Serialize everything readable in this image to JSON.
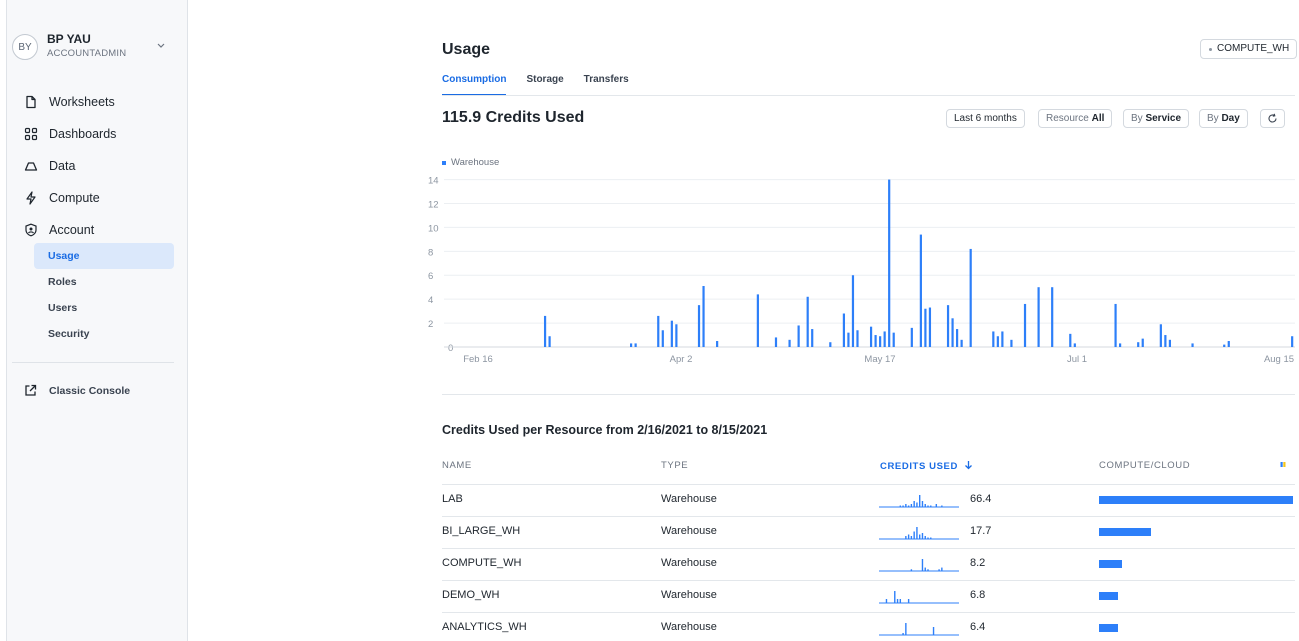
{
  "user": {
    "initials": "BY",
    "name": "BP YAU",
    "role": "ACCOUNTADMIN"
  },
  "nav": {
    "items": [
      {
        "label": "Worksheets",
        "icon": "file-icon"
      },
      {
        "label": "Dashboards",
        "icon": "grid-icon"
      },
      {
        "label": "Data",
        "icon": "cloud-icon"
      },
      {
        "label": "Compute",
        "icon": "bolt-icon"
      },
      {
        "label": "Account",
        "icon": "shield-icon"
      }
    ],
    "subitems": [
      "Usage",
      "Roles",
      "Users",
      "Security"
    ],
    "active_subitem": "Usage",
    "classic": "Classic Console"
  },
  "header": {
    "title": "Usage",
    "warehouse": "COMPUTE_WH",
    "tabs": [
      "Consumption",
      "Storage",
      "Transfers"
    ],
    "active_tab": "Consumption"
  },
  "summary": {
    "credits": "115.9 Credits Used"
  },
  "filters": {
    "range": "Last 6 months",
    "resource_label": "Resource",
    "resource_value": "All",
    "service_label": "By",
    "service_value": "Service",
    "day_label": "By",
    "day_value": "Day"
  },
  "colors": {
    "accent": "#1a6ce4",
    "bar": "#2d7ff9",
    "cloud": "#f5c518"
  },
  "chart_data": {
    "type": "bar",
    "series": [
      {
        "name": "Warehouse"
      }
    ],
    "x_start": "2021-02-16",
    "x_end": "2021-08-15",
    "xticks": [
      "Feb 16",
      "Apr 2",
      "May 17",
      "Jul 1",
      "Aug 15"
    ],
    "yticks": [
      0,
      2,
      4,
      6,
      8,
      10,
      12,
      14
    ],
    "ylim": [
      0,
      14.8
    ],
    "points": [
      [
        "2021-03-05",
        2.6
      ],
      [
        "2021-03-06",
        0.9
      ],
      [
        "2021-03-24",
        0.3
      ],
      [
        "2021-03-25",
        0.3
      ],
      [
        "2021-03-30",
        2.6
      ],
      [
        "2021-03-31",
        1.4
      ],
      [
        "2021-04-02",
        2.2
      ],
      [
        "2021-04-03",
        1.9
      ],
      [
        "2021-04-08",
        3.5
      ],
      [
        "2021-04-09",
        5.1
      ],
      [
        "2021-04-12",
        0.5
      ],
      [
        "2021-04-21",
        4.4
      ],
      [
        "2021-04-25",
        0.8
      ],
      [
        "2021-04-28",
        0.6
      ],
      [
        "2021-04-30",
        1.8
      ],
      [
        "2021-05-02",
        4.2
      ],
      [
        "2021-05-03",
        1.5
      ],
      [
        "2021-05-07",
        0.4
      ],
      [
        "2021-05-10",
        2.8
      ],
      [
        "2021-05-11",
        1.2
      ],
      [
        "2021-05-12",
        6.0
      ],
      [
        "2021-05-13",
        1.4
      ],
      [
        "2021-05-16",
        1.7
      ],
      [
        "2021-05-17",
        1.0
      ],
      [
        "2021-05-18",
        0.9
      ],
      [
        "2021-05-19",
        1.3
      ],
      [
        "2021-05-20",
        14.0
      ],
      [
        "2021-05-21",
        1.2
      ],
      [
        "2021-05-25",
        1.6
      ],
      [
        "2021-05-27",
        9.4
      ],
      [
        "2021-05-28",
        3.2
      ],
      [
        "2021-05-29",
        3.3
      ],
      [
        "2021-06-02",
        3.5
      ],
      [
        "2021-06-03",
        2.4
      ],
      [
        "2021-06-04",
        1.5
      ],
      [
        "2021-06-05",
        0.6
      ],
      [
        "2021-06-07",
        8.2
      ],
      [
        "2021-06-12",
        1.3
      ],
      [
        "2021-06-13",
        0.9
      ],
      [
        "2021-06-14",
        1.3
      ],
      [
        "2021-06-16",
        0.6
      ],
      [
        "2021-06-19",
        3.6
      ],
      [
        "2021-06-22",
        5.0
      ],
      [
        "2021-06-25",
        5.0
      ],
      [
        "2021-06-29",
        1.1
      ],
      [
        "2021-06-30",
        0.3
      ],
      [
        "2021-07-09",
        3.6
      ],
      [
        "2021-07-10",
        0.3
      ],
      [
        "2021-07-14",
        0.4
      ],
      [
        "2021-07-15",
        0.7
      ],
      [
        "2021-07-19",
        1.9
      ],
      [
        "2021-07-20",
        1.0
      ],
      [
        "2021-07-21",
        0.6
      ],
      [
        "2021-07-26",
        0.3
      ],
      [
        "2021-08-02",
        0.2
      ],
      [
        "2021-08-03",
        0.5
      ],
      [
        "2021-08-17",
        0.9
      ]
    ]
  },
  "table": {
    "title": "Credits Used per Resource from 2/16/2021 to 8/15/2021",
    "columns": [
      "NAME",
      "TYPE",
      "CREDITS USED",
      "COMPUTE/CLOUD"
    ],
    "rows": [
      {
        "name": "LAB",
        "type": "Warehouse",
        "credits": "66.4",
        "share": 1.0,
        "spark": [
          0,
          0,
          0,
          0,
          0,
          0,
          1,
          1,
          2,
          1,
          2,
          4,
          3,
          8,
          4,
          2,
          1,
          1,
          0,
          2,
          0,
          1,
          0,
          0,
          0,
          0
        ]
      },
      {
        "name": "BI_LARGE_WH",
        "type": "Warehouse",
        "credits": "17.7",
        "share": 0.27,
        "spark": [
          0,
          0,
          0,
          0,
          0,
          0,
          0,
          0,
          2,
          3,
          2,
          5,
          8,
          3,
          4,
          2,
          1,
          1,
          0,
          0,
          0,
          0,
          0,
          0,
          0,
          0
        ]
      },
      {
        "name": "COMPUTE_WH",
        "type": "Warehouse",
        "credits": "8.2",
        "share": 0.12,
        "spark": [
          0,
          0,
          0,
          0,
          0,
          0,
          0,
          0,
          0,
          0,
          1,
          0,
          0,
          0,
          7,
          2,
          1,
          0,
          0,
          0,
          1,
          2,
          0,
          0,
          0,
          0
        ]
      },
      {
        "name": "DEMO_WH",
        "type": "Warehouse",
        "credits": "6.8",
        "share": 0.1,
        "spark": [
          0,
          1,
          0,
          0,
          3,
          1,
          1,
          0,
          0,
          1,
          0,
          0,
          0,
          0,
          0,
          0,
          0,
          0,
          0,
          0,
          0,
          0,
          0,
          0,
          0,
          0
        ]
      },
      {
        "name": "ANALYTICS_WH",
        "type": "Warehouse",
        "credits": "6.4",
        "share": 0.1,
        "spark": [
          0,
          0,
          0,
          0,
          0,
          0,
          0,
          1,
          6,
          0,
          0,
          0,
          0,
          0,
          0,
          0,
          0,
          0,
          4,
          0,
          0,
          0,
          0,
          0,
          0,
          0
        ]
      }
    ]
  }
}
